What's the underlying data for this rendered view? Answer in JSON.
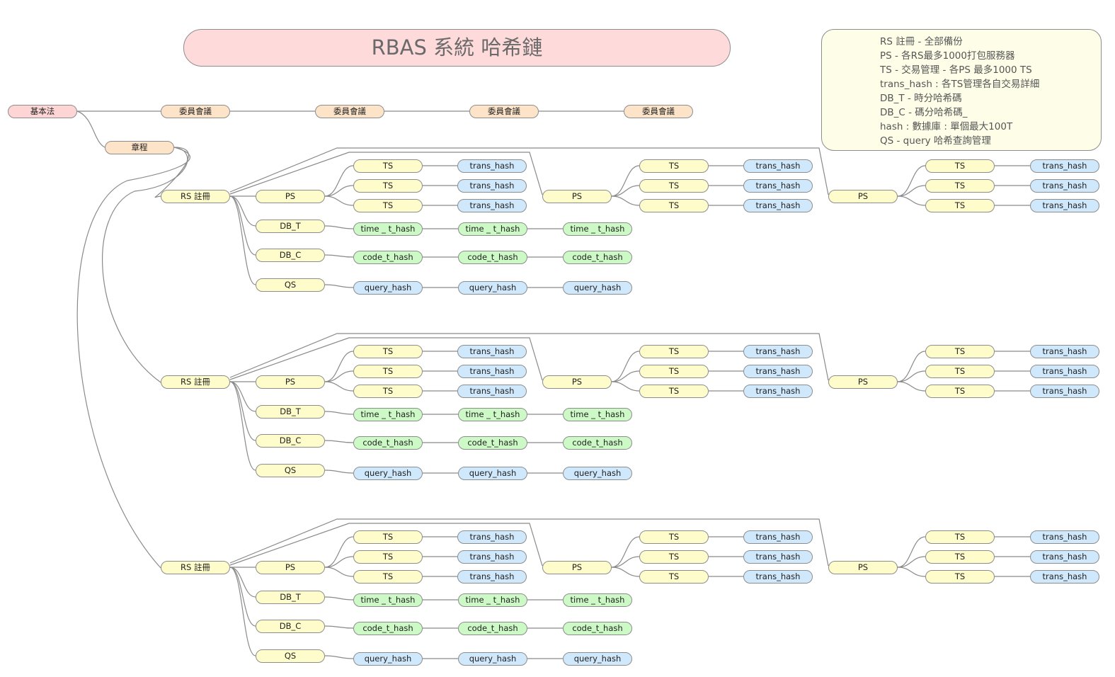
{
  "title": "RBAS 系統 哈希鏈",
  "legend": [
    "RS 註冊 - 全部備份",
    "PS - 各RS最多1000打包服務器",
    "TS - 交易管理 - 各PS 最多1000 TS",
    "trans_hash : 各TS管理各自交易詳細",
    "DB_T - 時分哈希碼",
    "DB_C - 碼分哈希碼_",
    "hash : 數據庫 : 單個最大100T",
    "QS - query 哈希查詢管理"
  ],
  "labels": {
    "basic_law": "基本法",
    "committee": "委員會議",
    "charter": "章程",
    "rs": "RS 註冊",
    "ps": "PS",
    "ts": "TS",
    "trans_hash": "trans_hash",
    "db_t": "DB_T",
    "db_c": "DB_C",
    "qs": "QS",
    "time_hash": "time _ t_hash",
    "code_hash": "code_t_hash",
    "query_hash": "query_hash"
  },
  "colors": {
    "root": "#fdd5d5",
    "peach": "#fde3c8",
    "yellow": "#fefcca",
    "blue": "#cfe8fc",
    "green": "#ccf9c5",
    "line": "#8a8a8a"
  }
}
